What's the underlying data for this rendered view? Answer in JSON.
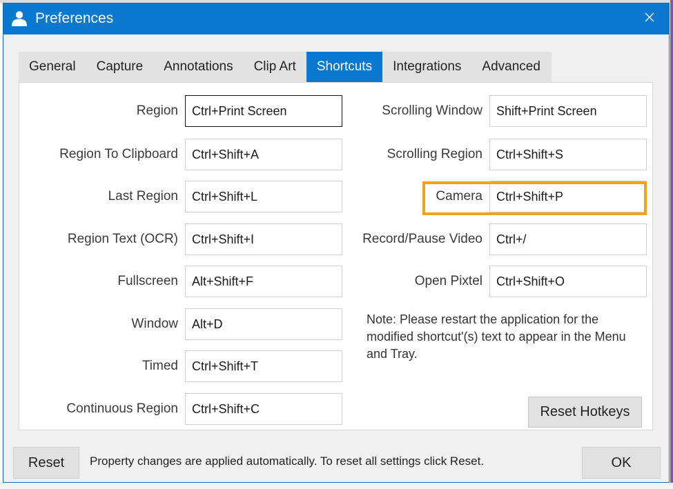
{
  "window": {
    "title": "Preferences",
    "accent_color": "#0b78d0",
    "highlight_color": "#f3a21b",
    "title_icon": "user-silhouette-icon",
    "close_icon": "close-icon"
  },
  "tabs": [
    {
      "label": "General",
      "active": false
    },
    {
      "label": "Capture",
      "active": false
    },
    {
      "label": "Annotations",
      "active": false
    },
    {
      "label": "Clip Art",
      "active": false
    },
    {
      "label": "Shortcuts",
      "active": true
    },
    {
      "label": "Integrations",
      "active": false
    },
    {
      "label": "Advanced",
      "active": false
    }
  ],
  "shortcuts_left": [
    {
      "label": "Region",
      "value": "Ctrl+Print Screen"
    },
    {
      "label": "Region To Clipboard",
      "value": "Ctrl+Shift+A"
    },
    {
      "label": "Last Region",
      "value": "Ctrl+Shift+L"
    },
    {
      "label": "Region Text (OCR)",
      "value": "Ctrl+Shift+I"
    },
    {
      "label": "Fullscreen",
      "value": "Alt+Shift+F"
    },
    {
      "label": "Window",
      "value": "Alt+D"
    },
    {
      "label": "Timed",
      "value": "Ctrl+Shift+T"
    },
    {
      "label": "Continuous Region",
      "value": "Ctrl+Shift+C"
    }
  ],
  "shortcuts_right": [
    {
      "label": "Scrolling Window",
      "value": "Shift+Print Screen"
    },
    {
      "label": "Scrolling Region",
      "value": "Ctrl+Shift+S"
    },
    {
      "label": "Camera",
      "value": "Ctrl+Shift+P"
    },
    {
      "label": "Record/Pause Video",
      "value": "Ctrl+/"
    },
    {
      "label": "Open Pixtel",
      "value": "Ctrl+Shift+O"
    }
  ],
  "focused_field": "Region",
  "highlighted_field": "Camera",
  "note": "Note: Please restart the application for the modified shortcut'(s) text to appear in the Menu and Tray.",
  "reset_hotkeys_label": "Reset Hotkeys",
  "footer": {
    "reset_label": "Reset",
    "message": "Property changes are applied automatically. To reset all settings click Reset.",
    "ok_label": "OK"
  }
}
